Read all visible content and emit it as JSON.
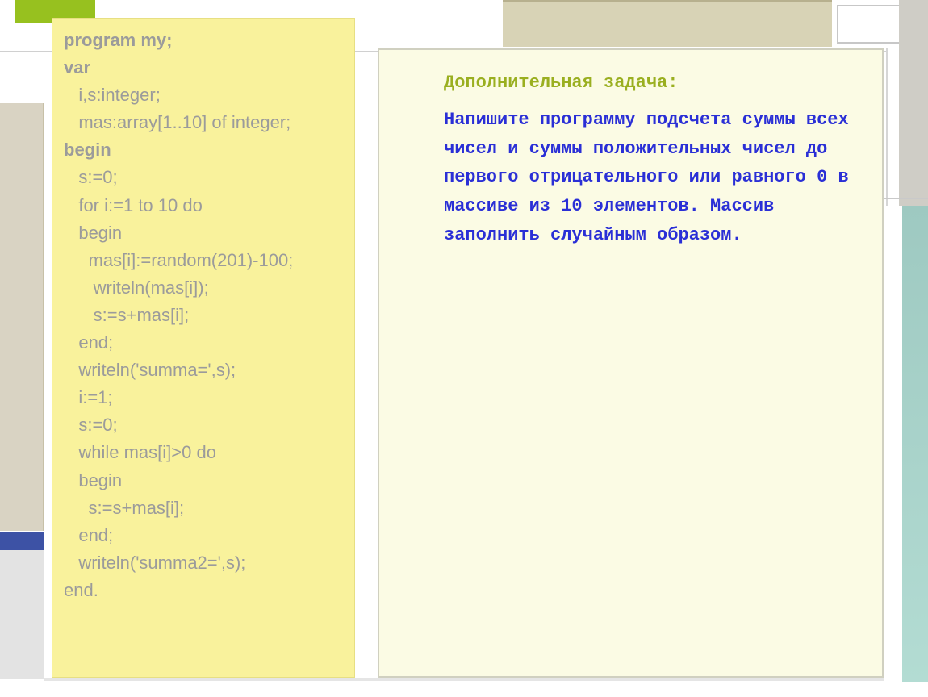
{
  "code": {
    "lines": [
      {
        "text": "program my;",
        "bold": true
      },
      {
        "text": "var",
        "bold": true
      },
      {
        "text": "   i,s:integer;",
        "bold": false
      },
      {
        "text": "   mas:array[1..10] of integer;",
        "bold": false
      },
      {
        "text": "begin",
        "bold": true
      },
      {
        "text": "   s:=0;",
        "bold": false
      },
      {
        "text": "   for i:=1 to 10 do",
        "bold": false
      },
      {
        "text": "   begin",
        "bold": false
      },
      {
        "text": "     mas[i]:=random(201)-100;",
        "bold": false
      },
      {
        "text": "      writeln(mas[i]);",
        "bold": false
      },
      {
        "text": "      s:=s+mas[i];",
        "bold": false
      },
      {
        "text": "   end;",
        "bold": false
      },
      {
        "text": "   writeln('summa=',s);",
        "bold": false
      },
      {
        "text": "   i:=1;",
        "bold": false
      },
      {
        "text": "   s:=0;",
        "bold": false
      },
      {
        "text": "   while mas[i]>0 do",
        "bold": false
      },
      {
        "text": "   begin",
        "bold": false
      },
      {
        "text": "     s:=s+mas[i];",
        "bold": false
      },
      {
        "text": "   end;",
        "bold": false
      },
      {
        "text": "   writeln('summa2=',s);",
        "bold": false
      },
      {
        "text": "end.",
        "bold": false
      }
    ]
  },
  "task": {
    "title": "Дополнительная задача:",
    "body": "Напишите программу подсчета суммы всех чисел и суммы положительных чисел до первого отрицательного или равного 0 в массиве из 10 элементов. Массив заполнить случайным образом."
  }
}
